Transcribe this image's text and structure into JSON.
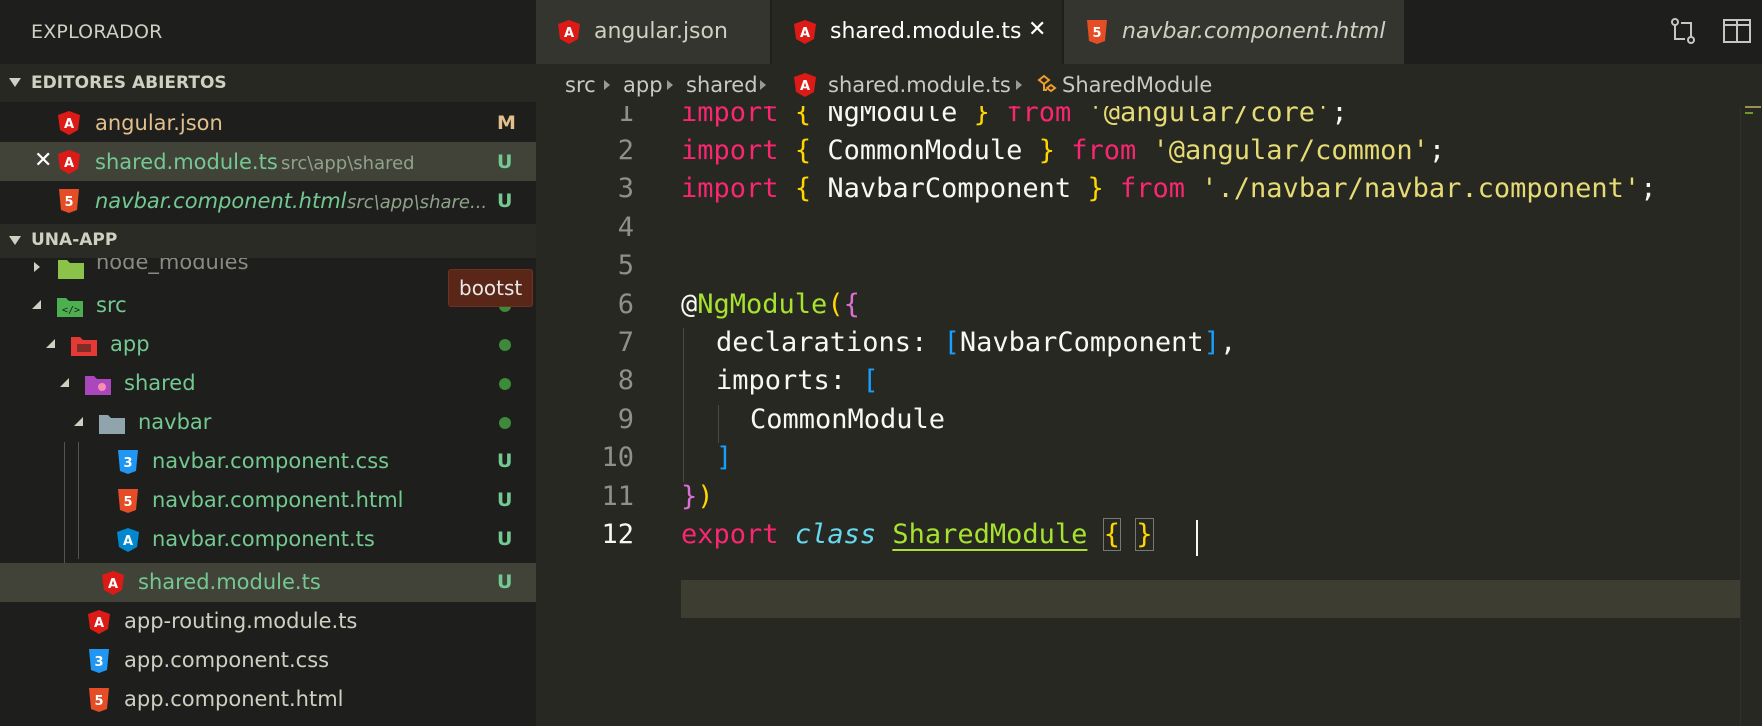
{
  "sidebar": {
    "title": "EXPLORADOR",
    "open_editors_section": "EDITORES ABIERTOS",
    "project_section": "UNA-APP",
    "open_editors": [
      {
        "name": "angular.json",
        "path": "",
        "badge": "M",
        "icon": "angular-icon"
      },
      {
        "name": "shared.module.ts",
        "path": "src\\app\\shared",
        "badge": "U",
        "icon": "angular-icon"
      },
      {
        "name": "navbar.component.html",
        "path": "src\\app\\share...",
        "badge": "U",
        "icon": "html5-icon"
      }
    ],
    "tree": {
      "node_modules": "node_modules",
      "src": "src",
      "app": "app",
      "shared": "shared",
      "navbar": "navbar",
      "navbar_css": "navbar.component.css",
      "navbar_html": "navbar.component.html",
      "navbar_ts": "navbar.component.ts",
      "shared_module": "shared.module.ts",
      "app_routing": "app-routing.module.ts",
      "app_css": "app.component.css",
      "app_html": "app.component.html",
      "untracked_badge": "U"
    },
    "tooltip": "bootst"
  },
  "tabs": [
    {
      "label": "angular.json",
      "icon": "angular-icon"
    },
    {
      "label": "shared.module.ts",
      "icon": "angular-icon"
    },
    {
      "label": "navbar.component.html",
      "icon": "html5-icon"
    }
  ],
  "breadcrumb": {
    "src": "src",
    "app": "app",
    "shared": "shared",
    "file": "shared.module.ts",
    "symbol": "SharedModule"
  },
  "editor": {
    "line_numbers": [
      "1",
      "2",
      "3",
      "4",
      "5",
      "6",
      "7",
      "8",
      "9",
      "10",
      "11",
      "12"
    ],
    "tokens": {
      "import": "import",
      "from": "from",
      "lbrace": "{",
      "rbrace": "}",
      "semicolon": ";",
      "ngmodule": "NgModule",
      "commonmodule": "CommonModule",
      "navbarcomponent": "NavbarComponent",
      "str_core": "'@angular/core'",
      "str_common": "'@angular/common'",
      "str_navbar": "'./navbar/navbar.component'",
      "at": "@",
      "lparen": "(",
      "rparen": ")",
      "declarations": "declarations: ",
      "imports": "imports: ",
      "lbracket": "[",
      "rbracket": "]",
      "comma": ",",
      "export": "export",
      "class": "class",
      "sharedmodule": "SharedModule"
    }
  },
  "colors": {
    "keyword": "#f92672",
    "string": "#e6db74",
    "class_name": "#a6e22e",
    "git_modified": "#e2c08d",
    "git_untracked": "#73c991"
  }
}
